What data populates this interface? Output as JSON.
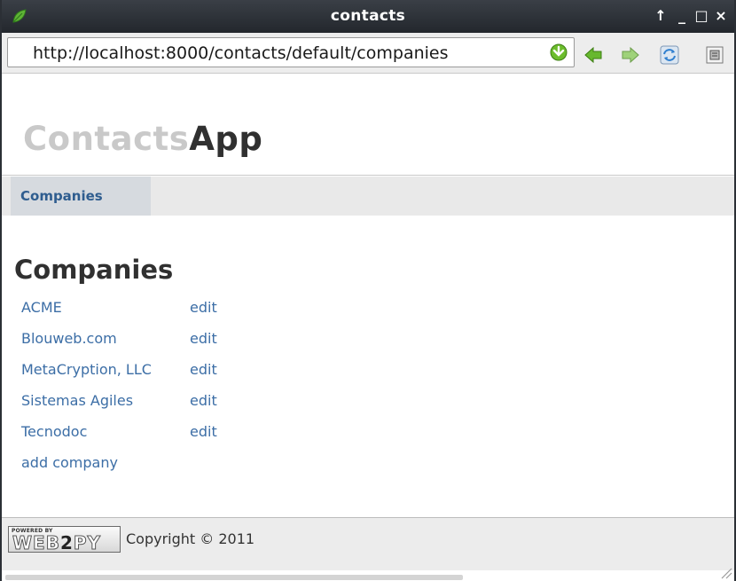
{
  "window": {
    "title": "contacts",
    "controls": {
      "move": "↑",
      "minimize": "_",
      "maximize": "□",
      "close": "×"
    }
  },
  "browser": {
    "url": "http://localhost:8000/contacts/default/companies",
    "icons": [
      "go-icon",
      "back-icon",
      "forward-icon",
      "reload-icon",
      "page-icon"
    ]
  },
  "app": {
    "brand_light": "Contacts",
    "brand_dark": "App"
  },
  "menu": {
    "items": [
      {
        "label": "Companies"
      }
    ]
  },
  "main": {
    "heading": "Companies",
    "companies": [
      {
        "name": "ACME",
        "action": "edit"
      },
      {
        "name": "Blouweb.com",
        "action": "edit"
      },
      {
        "name": "MetaCryption, LLC",
        "action": "edit"
      },
      {
        "name": "Sistemas Agiles",
        "action": "edit"
      },
      {
        "name": "Tecnodoc",
        "action": "edit"
      }
    ],
    "add_label": "add company"
  },
  "footer": {
    "powered_by": "POWERED BY",
    "badge_pre": "WEB",
    "badge_two": "2",
    "badge_post": "PY",
    "copyright": "Copyright © 2011"
  },
  "colors": {
    "link": "#3c6ea6",
    "menu_text": "#2f5d8f",
    "title_bar": "#2b2f35"
  }
}
